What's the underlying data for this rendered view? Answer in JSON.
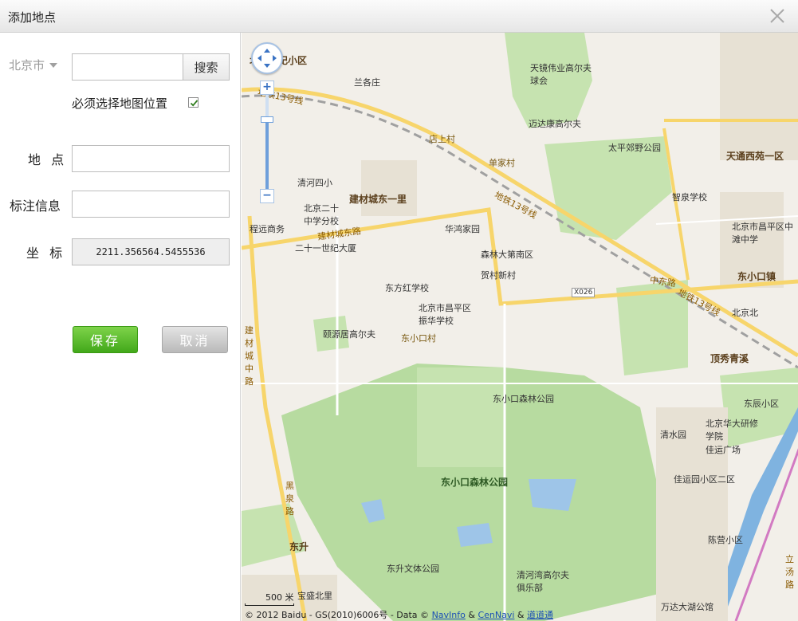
{
  "dialog": {
    "title": "添加地点"
  },
  "form": {
    "city": "北京市",
    "search_placeholder": "",
    "search_button": "搜索",
    "must_select_label": "必须选择地图位置",
    "must_select_checked": true,
    "place_label": "地  点",
    "place_value": "",
    "note_label": "标注信息",
    "note_value": "",
    "coord_label": "坐  标",
    "coord_value": "2211.356564.5455536",
    "save_button": "保存",
    "cancel_button": "取消"
  },
  "map": {
    "places": [
      {
        "text": "北京世纪小区",
        "cls": "b"
      },
      {
        "text": "兰各庄",
        "cls": ""
      },
      {
        "text": "天镜伟业高尔夫球会",
        "cls": ""
      },
      {
        "text": "地铁13号线",
        "cls": "road"
      },
      {
        "text": "店上村",
        "cls": "vil"
      },
      {
        "text": "迈达康高尔夫",
        "cls": ""
      },
      {
        "text": "太平郊野公园",
        "cls": ""
      },
      {
        "text": "天通西苑一区",
        "cls": "b"
      },
      {
        "text": "单家村",
        "cls": "vil"
      },
      {
        "text": "清河四小",
        "cls": ""
      },
      {
        "text": "智泉学校",
        "cls": ""
      },
      {
        "text": "建材城东一里",
        "cls": "b"
      },
      {
        "text": "地铁13号线",
        "cls": "road"
      },
      {
        "text": "北京二十中学分校",
        "cls": ""
      },
      {
        "text": "华鸿家园",
        "cls": ""
      },
      {
        "text": "北京市昌平区中滩中学",
        "cls": ""
      },
      {
        "text": "程远商务",
        "cls": ""
      },
      {
        "text": "建材城东路",
        "cls": "road"
      },
      {
        "text": "二十一世纪大厦",
        "cls": ""
      },
      {
        "text": "森林大第南区",
        "cls": ""
      },
      {
        "text": "贺村新村",
        "cls": ""
      },
      {
        "text": "东方红学校",
        "cls": ""
      },
      {
        "text": "中东路",
        "cls": "road"
      },
      {
        "text": "东小口镇",
        "cls": "b"
      },
      {
        "text": "X026",
        "cls": ""
      },
      {
        "text": "北京市昌平区振华学校",
        "cls": ""
      },
      {
        "text": "地铁13号线",
        "cls": "road"
      },
      {
        "text": "北京北",
        "cls": ""
      },
      {
        "text": "颐源居高尔夫",
        "cls": ""
      },
      {
        "text": "东小口村",
        "cls": "vil"
      },
      {
        "text": "建材城中路",
        "cls": "road"
      },
      {
        "text": "顶秀青溪",
        "cls": "b"
      },
      {
        "text": "东小口森林公园",
        "cls": ""
      },
      {
        "text": "东辰小区",
        "cls": ""
      },
      {
        "text": "北京华大研修学院",
        "cls": ""
      },
      {
        "text": "清水园",
        "cls": ""
      },
      {
        "text": "佳运广场",
        "cls": ""
      },
      {
        "text": "东小口森林公园",
        "cls": "park"
      },
      {
        "text": "佳运园小区二区",
        "cls": ""
      },
      {
        "text": "黑泉路",
        "cls": "road"
      },
      {
        "text": "陈营小区",
        "cls": ""
      },
      {
        "text": "东升",
        "cls": "b"
      },
      {
        "text": "东升文体公园",
        "cls": ""
      },
      {
        "text": "清河湾高尔夫俱乐部",
        "cls": ""
      },
      {
        "text": "宝盛北里",
        "cls": ""
      },
      {
        "text": "万达大湖公馆",
        "cls": ""
      },
      {
        "text": "立汤路",
        "cls": "road"
      }
    ],
    "scale_label": "500 米",
    "copyright": "© 2012 Baidu - GS(2010)6006号 - Data ©",
    "copyright_link1": "NavInfo",
    "copyright_amp1": "&",
    "copyright_link2": "CenNavi",
    "copyright_amp2": "&",
    "copyright_link3": "道道通",
    "zoom_in": "+",
    "zoom_out": "−",
    "icons": [
      "close-icon",
      "pan-control-icon",
      "checkmark-icon"
    ]
  },
  "colors": {
    "accent_green": "#42a81a",
    "park_green": "#b7dba0",
    "road_yellow": "#f7d56b",
    "water_blue": "#9ec5e8"
  }
}
